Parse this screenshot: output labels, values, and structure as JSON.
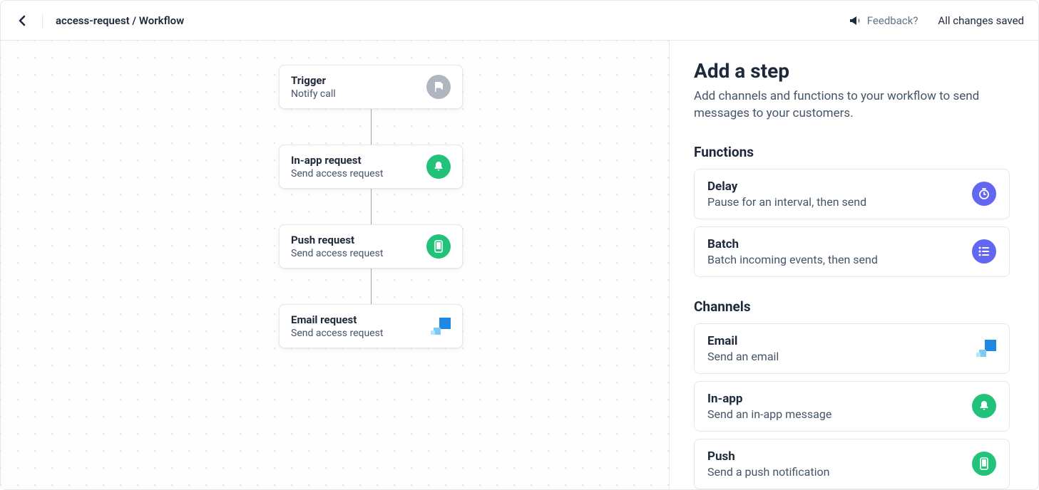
{
  "header": {
    "breadcrumb": "access-request / Workflow",
    "feedback_label": "Feedback?",
    "save_status": "All changes saved"
  },
  "flow": {
    "nodes": [
      {
        "title": "Trigger",
        "subtitle": "Notify call",
        "icon": "flag"
      },
      {
        "title": "In-app request",
        "subtitle": "Send access request",
        "icon": "bell"
      },
      {
        "title": "Push request",
        "subtitle": "Send access request",
        "icon": "phone"
      },
      {
        "title": "Email request",
        "subtitle": "Send access request",
        "icon": "email"
      }
    ]
  },
  "sidebar": {
    "title": "Add a step",
    "description": "Add channels and functions to your workflow to send messages to your customers.",
    "functions_title": "Functions",
    "functions": [
      {
        "title": "Delay",
        "subtitle": "Pause for an interval, then send",
        "icon": "clock"
      },
      {
        "title": "Batch",
        "subtitle": "Batch incoming events, then send",
        "icon": "list"
      }
    ],
    "channels_title": "Channels",
    "channels": [
      {
        "title": "Email",
        "subtitle": "Send an email",
        "icon": "email"
      },
      {
        "title": "In-app",
        "subtitle": "Send an in-app message",
        "icon": "bell"
      },
      {
        "title": "Push",
        "subtitle": "Send a push notification",
        "icon": "phone"
      }
    ]
  }
}
